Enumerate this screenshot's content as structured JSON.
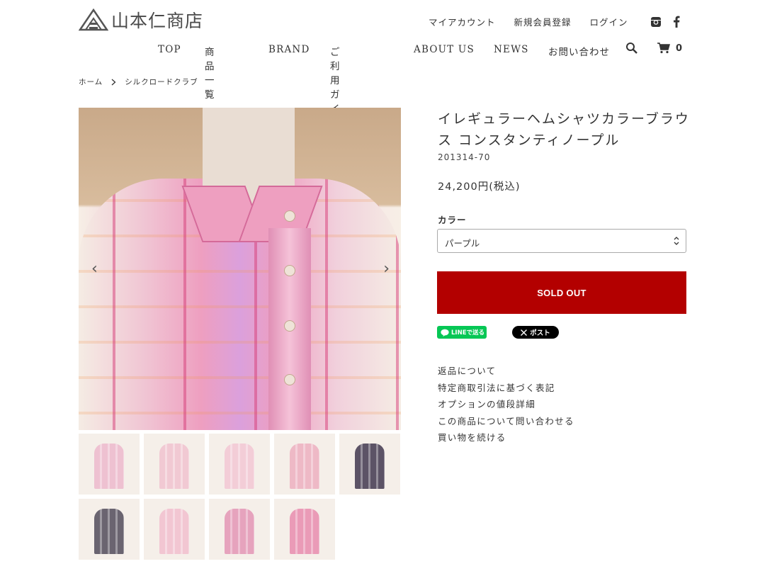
{
  "header": {
    "logo_text": "山本仁商店",
    "account_links": [
      "マイアカウント",
      "新規会員登録",
      "ログイン"
    ],
    "social_icons": [
      "instagram-icon",
      "facebook-icon"
    ]
  },
  "nav": {
    "items": [
      "TOP",
      "商品一覧",
      "BRAND",
      "ご利用ガイド",
      "ABOUT US",
      "NEWS",
      "お問い合わせ"
    ],
    "cart_count": "0"
  },
  "breadcrumb": {
    "home": "ホーム",
    "current": "シルクロードクラブ"
  },
  "product": {
    "title": "イレギュラーヘムシャツカラーブラウス コンスタンティノープル",
    "sku": "201314-70",
    "price": "24,200円(税込)",
    "color_label": "カラー",
    "color_selected": "パープル",
    "sold_out_label": "SOLD OUT"
  },
  "share": {
    "line_label": "LINEで送る",
    "x_label": "ポスト"
  },
  "info_links": [
    "返品について",
    "特定商取引法に基づく表記",
    "オプションの値段詳細",
    "この商品について問い合わせる",
    "買い物を続ける"
  ],
  "colors": {
    "sold_out": "#b30000",
    "line_green": "#06c755",
    "x_black": "#000000"
  },
  "gallery": {
    "thumb_count": 9,
    "thumb_tones": [
      "#eec1d1",
      "#f1c9d3",
      "#f3cdd7",
      "#eeb9c6",
      "#5c5366",
      "#6a6470",
      "#f2c6d2",
      "#e6a3bd",
      "#ea9bb7"
    ]
  }
}
